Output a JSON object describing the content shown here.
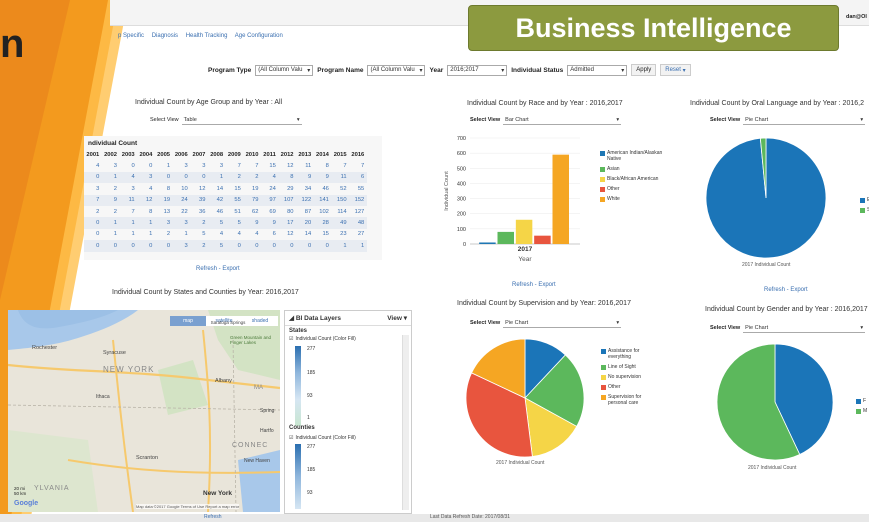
{
  "app": {
    "left_title": "n",
    "banner": "Business Intelligence",
    "user": "dan@Ol"
  },
  "nav": [
    "p Specific",
    "Diagnosis",
    "Health Tracking",
    "Age Configuration"
  ],
  "filters": {
    "program_type_label": "Program Type",
    "program_type_value": "(All Column Valu",
    "program_name_label": "Program Name",
    "program_name_value": "(All Column Valu",
    "year_label": "Year",
    "year_value": "2016;2017",
    "status_label": "Individual Status",
    "status_value": "Admitted",
    "apply": "Apply",
    "reset": "Reset"
  },
  "age_panel": {
    "title": "Individual Count by Age Group and by Year : All",
    "select_label": "Select View",
    "select_value": "Table",
    "table_title": "ndividual Count",
    "years": [
      "2001",
      "2002",
      "2003",
      "2004",
      "2005",
      "2006",
      "2007",
      "2008",
      "2009",
      "2010",
      "2011",
      "2012",
      "2013",
      "2014",
      "2015",
      "2016"
    ],
    "rows": [
      [
        "4",
        "3",
        "0",
        "0",
        "1",
        "3",
        "3",
        "3",
        "7",
        "7",
        "15",
        "12",
        "11",
        "8",
        "7",
        "7"
      ],
      [
        "0",
        "1",
        "4",
        "3",
        "0",
        "0",
        "0",
        "1",
        "2",
        "2",
        "4",
        "8",
        "9",
        "9",
        "11",
        "6"
      ],
      [
        "3",
        "2",
        "3",
        "4",
        "8",
        "10",
        "12",
        "14",
        "15",
        "19",
        "24",
        "29",
        "34",
        "46",
        "52",
        "55"
      ],
      [
        "7",
        "9",
        "11",
        "12",
        "19",
        "24",
        "39",
        "42",
        "55",
        "79",
        "97",
        "107",
        "122",
        "141",
        "150",
        "152"
      ],
      [
        "2",
        "2",
        "7",
        "8",
        "13",
        "22",
        "36",
        "46",
        "51",
        "62",
        "69",
        "80",
        "87",
        "102",
        "114",
        "127"
      ],
      [
        "0",
        "1",
        "1",
        "1",
        "3",
        "3",
        "2",
        "5",
        "5",
        "9",
        "9",
        "17",
        "20",
        "28",
        "49",
        "48"
      ],
      [
        "0",
        "1",
        "1",
        "1",
        "2",
        "1",
        "5",
        "4",
        "4",
        "4",
        "6",
        "12",
        "14",
        "15",
        "23",
        "27"
      ],
      [
        "0",
        "0",
        "0",
        "0",
        "0",
        "3",
        "2",
        "5",
        "0",
        "0",
        "0",
        "0",
        "0",
        "0",
        "1",
        "1"
      ]
    ],
    "footer": "Refresh - Export"
  },
  "race_panel": {
    "title": "Individual Count by Race and by Year : 2016,2017",
    "select_label": "Select View",
    "select_value": "Bar Chart",
    "footer": "Refresh - Export"
  },
  "oral_panel": {
    "title": "Individual Count by Oral Language and by Year : 2016,2",
    "select_label": "Select View",
    "select_value": "Pie Chart",
    "caption": "2017 Individual Count",
    "footer": "Refresh - Export"
  },
  "supervision_panel": {
    "title": "Individual Count by Supervision and by Year: 2016,2017",
    "select_label": "Select View",
    "select_value": "Pie Chart",
    "caption": "2017 Individual Count"
  },
  "gender_panel": {
    "title": "Individual Count by Gender and by Year : 2016,2017",
    "select_label": "Select View",
    "select_value": "Pie Chart",
    "caption": "2017 Individual Count"
  },
  "map_panel": {
    "title": "Individual Count by States and Counties by Year: 2016,2017",
    "map_buttons": [
      "map",
      "satellite",
      "shaded"
    ],
    "labels": [
      "Rochester",
      "Syracuse",
      "NEW YORK",
      "Ithaca",
      "Albany",
      "Scranton",
      "New York",
      "CONNEC",
      "Saratoga Springs",
      "Green Mountain and Finger Lakes",
      "Hartfo",
      "New Haven",
      "Spring",
      "YLVANIA",
      "MA"
    ],
    "scale": "20 mi\n50 km",
    "attribution": "Map data ©2017 Google  Terms of Use  Report a map error",
    "google": "Google",
    "layers_title": "BI Data Layers",
    "view": "View",
    "states": "States",
    "counties": "Counties",
    "layer_item": "Individual Count (Color Fill)",
    "state_scale": [
      "277",
      "185",
      "93",
      "1"
    ],
    "county_scale": [
      "277",
      "185",
      "93"
    ]
  },
  "bottom": {
    "refresh": "Refresh",
    "last_refresh": "Last Data Refresh Date: 2017/08/31"
  },
  "chart_data": [
    {
      "type": "bar",
      "title": "Individual Count by Race and by Year : 2016,2017",
      "categories": [
        "2017"
      ],
      "xlabel": "Year",
      "ylabel": "Individual Count",
      "ylim": [
        0,
        700
      ],
      "yticks": [
        "0",
        "100",
        "200",
        "300",
        "400",
        "500",
        "600",
        "700"
      ],
      "series": [
        {
          "name": "American Indian/Alaskan Native",
          "values": [
            10
          ],
          "color": "#1f77b4"
        },
        {
          "name": "Asian",
          "values": [
            80
          ],
          "color": "#5cb85c"
        },
        {
          "name": "Black/African American",
          "values": [
            160
          ],
          "color": "#f5d547"
        },
        {
          "name": "Other",
          "values": [
            55
          ],
          "color": "#e8553e"
        },
        {
          "name": "White",
          "values": [
            590
          ],
          "color": "#f5a623"
        }
      ],
      "legend": "right"
    },
    {
      "type": "pie",
      "title": "Individual Count by Oral Language and by Year : 2016,2",
      "slices": [
        {
          "name": "E",
          "value": 98.5,
          "color": "#1b75b8"
        },
        {
          "name": "S",
          "value": 1.5,
          "color": "#5cb85c"
        }
      ],
      "legend": "right"
    },
    {
      "type": "pie",
      "title": "Individual Count by Supervision and by Year: 2016,2017",
      "slices": [
        {
          "name": "Assistance for everything",
          "value": 12,
          "color": "#1b75b8"
        },
        {
          "name": "Line of Sight",
          "value": 21,
          "color": "#5cb85c"
        },
        {
          "name": "No supervision",
          "value": 15,
          "color": "#f5d547"
        },
        {
          "name": "Other",
          "value": 34,
          "color": "#e8553e"
        },
        {
          "name": "Supervision for personal care",
          "value": 18,
          "color": "#f5a623"
        }
      ],
      "legend": "right"
    },
    {
      "type": "pie",
      "title": "Individual Count by Gender and by Year : 2016,2017",
      "slices": [
        {
          "name": "F",
          "value": 43,
          "color": "#1b75b8"
        },
        {
          "name": "M",
          "value": 57,
          "color": "#5cb85c"
        }
      ],
      "legend": "right"
    }
  ]
}
